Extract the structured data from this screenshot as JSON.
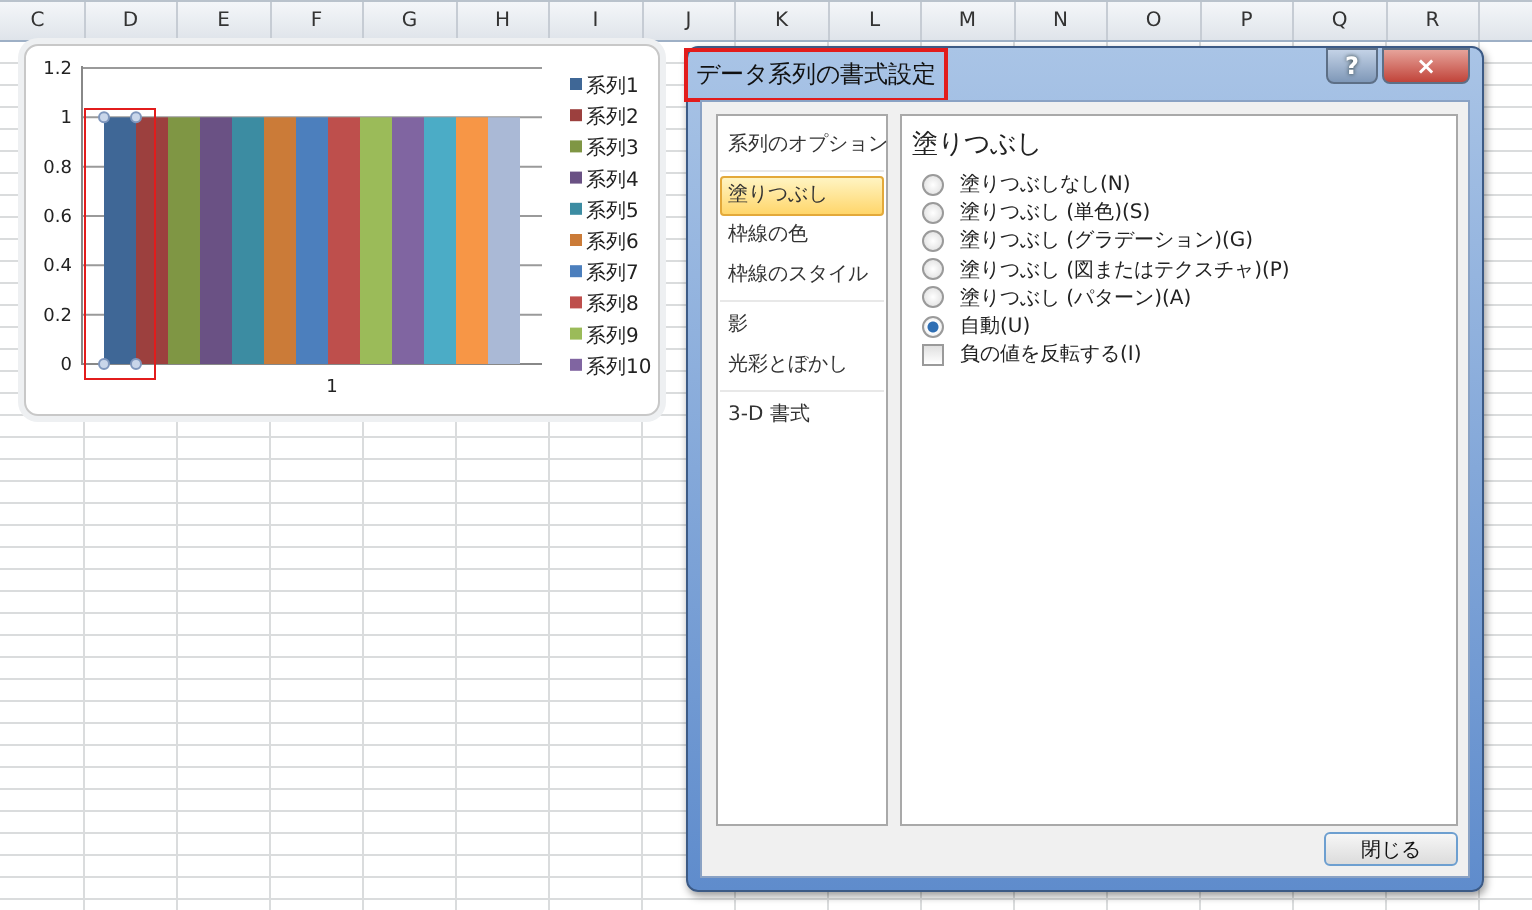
{
  "sheet": {
    "columns": [
      "C",
      "D",
      "E",
      "F",
      "G",
      "H",
      "I",
      "J",
      "K",
      "L",
      "M",
      "N",
      "O",
      "P",
      "Q",
      "R"
    ]
  },
  "chart": {
    "chart_data": {
      "type": "bar",
      "grid": "y",
      "legend": "right",
      "categories": [
        "1"
      ],
      "ylim": [
        0,
        1.2
      ],
      "yticks": [
        0,
        0.2,
        0.4,
        0.6,
        0.8,
        1,
        1.2
      ],
      "series": [
        {
          "name": "系列1",
          "color": "#3f6796",
          "values": [
            1
          ]
        },
        {
          "name": "系列2",
          "color": "#9c403e",
          "values": [
            1
          ]
        },
        {
          "name": "系列3",
          "color": "#7f9644",
          "values": [
            1
          ]
        },
        {
          "name": "系列4",
          "color": "#6a5184",
          "values": [
            1
          ]
        },
        {
          "name": "系列5",
          "color": "#3c8ca2",
          "values": [
            1
          ]
        },
        {
          "name": "系列6",
          "color": "#cb7b38",
          "values": [
            1
          ]
        },
        {
          "name": "系列7",
          "color": "#4c7fbd",
          "values": [
            1
          ]
        },
        {
          "name": "系列8",
          "color": "#be4f4c",
          "values": [
            1
          ]
        },
        {
          "name": "系列9",
          "color": "#9bbb59",
          "values": [
            1
          ]
        },
        {
          "name": "系列10",
          "color": "#8065a1",
          "values": [
            1
          ]
        },
        {
          "color": "#4bacc6",
          "values": [
            1
          ]
        },
        {
          "color": "#f79646",
          "values": [
            1
          ]
        },
        {
          "color": "#aab9d6",
          "values": [
            1
          ]
        }
      ]
    },
    "series_states": [
      {
        "selected": true
      },
      {
        "selected": false
      },
      {
        "selected": false
      },
      {
        "selected": false
      },
      {
        "selected": false
      },
      {
        "selected": false
      },
      {
        "selected": false
      },
      {
        "selected": false
      },
      {
        "selected": false
      },
      {
        "selected": false
      },
      {
        "selected": false
      },
      {
        "selected": false
      },
      {
        "selected": false
      }
    ]
  },
  "dialog": {
    "title": "データ系列の書式設定",
    "title_highlighted": true,
    "help_button": "?",
    "close_icon": "×",
    "nav_groups": [
      [
        {
          "label": "系列のオプション",
          "selected": false
        }
      ],
      [
        {
          "label": "塗りつぶし",
          "selected": true
        },
        {
          "label": "枠線の色",
          "selected": false
        },
        {
          "label": "枠線のスタイル",
          "selected": false
        }
      ],
      [
        {
          "label": "影",
          "selected": false
        },
        {
          "label": "光彩とぼかし",
          "selected": false
        }
      ],
      [
        {
          "label": "3-D 書式",
          "selected": false
        }
      ]
    ],
    "heading": "塗りつぶし",
    "options": [
      {
        "kind": "radio",
        "label": "塗りつぶしなし(N)",
        "selected": false
      },
      {
        "kind": "radio",
        "label": "塗りつぶし (単色)(S)",
        "selected": false
      },
      {
        "kind": "radio",
        "label": "塗りつぶし (グラデーション)(G)",
        "selected": false
      },
      {
        "kind": "radio",
        "label": "塗りつぶし (図またはテクスチャ)(P)",
        "selected": false
      },
      {
        "kind": "radio",
        "label": "塗りつぶし (パターン)(A)",
        "selected": false
      },
      {
        "kind": "radio",
        "label": "自動(U)",
        "selected": true
      },
      {
        "kind": "checkbox",
        "label": "負の値を反転する(I)",
        "checked": false
      }
    ],
    "close_button": "閉じる"
  }
}
